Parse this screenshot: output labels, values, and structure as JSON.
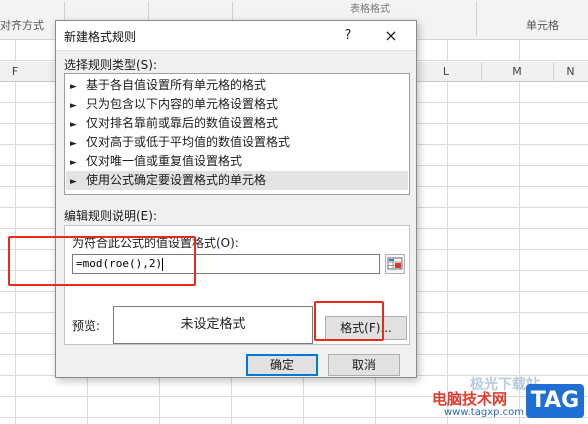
{
  "excel": {
    "ribbon": {
      "group_alignment": "对齐方式",
      "group_table_format": "表格格式",
      "group_cells": "单元格"
    },
    "columns": [
      "F",
      "",
      "",
      "",
      "",
      "",
      "L",
      "M",
      "N"
    ]
  },
  "dialog": {
    "title": "新建格式规则",
    "help": "?",
    "close": "×",
    "rule_type_label": "选择规则类型(S):",
    "rule_types": [
      "基于各自值设置所有单元格的格式",
      "只为包含以下内容的单元格设置格式",
      "仅对排名靠前或靠后的数值设置格式",
      "仅对高于或低于平均值的数值设置格式",
      "仅对唯一值或重复值设置格式",
      "使用公式确定要设置格式的单元格"
    ],
    "selected_index": 5,
    "edit_desc_label": "编辑规则说明(E):",
    "formula_label": "为符合此公式的值设置格式(O):",
    "formula_value": "=mod(roe(),2)",
    "preview_label": "预览:",
    "preview_text": "未设定格式",
    "format_button": "格式(F)...",
    "ok_button": "确定",
    "cancel_button": "取消"
  },
  "watermark": {
    "line1": "极光下载站",
    "line2": "电脑技术网",
    "url": "www.tagxp.com",
    "tag": "TAG"
  },
  "colors": {
    "highlight_red": "#e8291c",
    "accent_blue": "#0078d7",
    "watermark_blue": "#1f6fd4"
  }
}
